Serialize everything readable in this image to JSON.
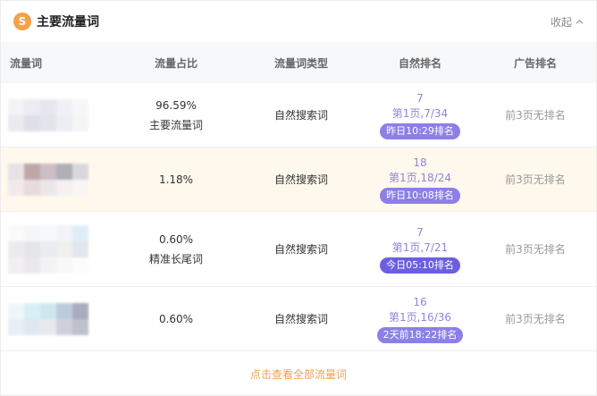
{
  "header": {
    "logo_glyph": "S",
    "title": "主要流量词",
    "collapse_label": "收起"
  },
  "columns": [
    "流量词",
    "流量占比",
    "流量词类型",
    "自然排名",
    "广告排名"
  ],
  "rows": [
    {
      "share": "96.59%",
      "tag": "主要流量词",
      "type": "自然搜索词",
      "rank_pos": "7",
      "rank_page": "第1页,7/34",
      "rank_time": "昨日10:29排名",
      "ad_rank": "前3页无排名",
      "highlight": false
    },
    {
      "share": "1.18%",
      "tag": "",
      "type": "自然搜索词",
      "rank_pos": "18",
      "rank_page": "第1页,18/24",
      "rank_time": "昨日10:08排名",
      "ad_rank": "前3页无排名",
      "highlight": true
    },
    {
      "share": "0.60%",
      "tag": "精准长尾词",
      "type": "自然搜索词",
      "rank_pos": "7",
      "rank_page": "第1页,7/21",
      "rank_time": "今日05:10排名",
      "ad_rank": "前3页无排名",
      "highlight": false
    },
    {
      "share": "0.60%",
      "tag": "",
      "type": "自然搜索词",
      "rank_pos": "16",
      "rank_page": "第1页,16/36",
      "rank_time": "2天前18:22排名",
      "ad_rank": "前3页无排名",
      "highlight": false
    }
  ],
  "footer": {
    "view_all_label": "点击查看全部流量词"
  },
  "colors": {
    "accent": "#f5a04a",
    "rank": "#8e86d8",
    "badge": "#8c7fe8",
    "highlight": "#fff8ec"
  }
}
